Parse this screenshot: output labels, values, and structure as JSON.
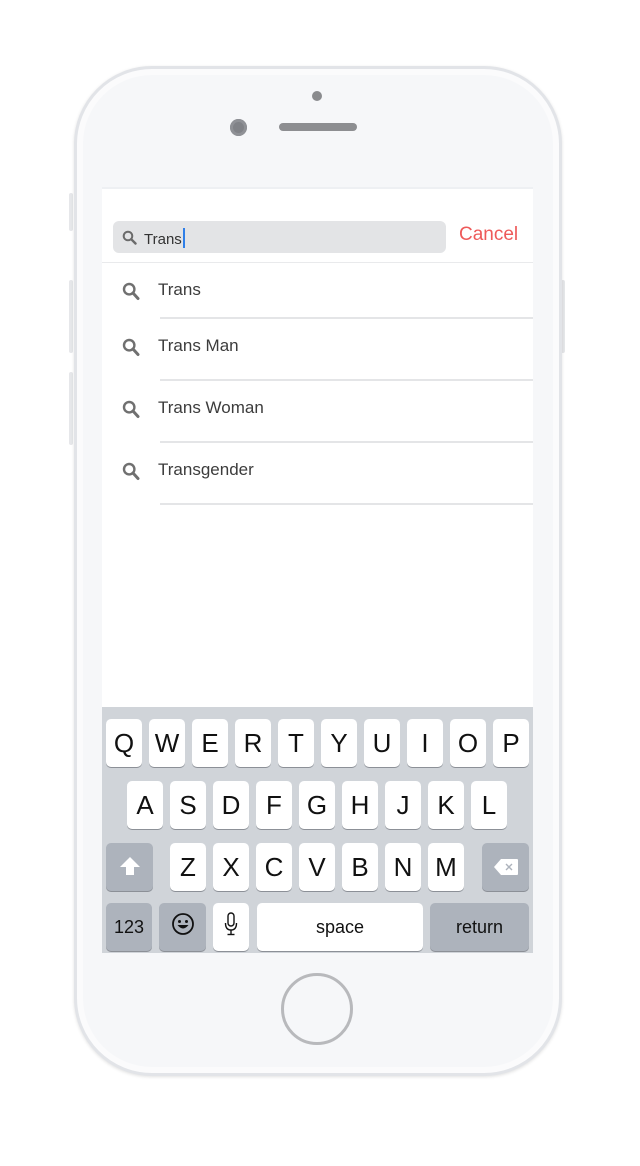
{
  "search": {
    "value": "Trans",
    "icon": "search-icon"
  },
  "cancel_label": "Cancel",
  "results": [
    {
      "label": "Trans",
      "icon": "search-icon"
    },
    {
      "label": "Trans Man",
      "icon": "search-icon"
    },
    {
      "label": "Trans Woman",
      "icon": "search-icon"
    },
    {
      "label": "Transgender",
      "icon": "search-icon"
    }
  ],
  "keyboard": {
    "row1": [
      "Q",
      "W",
      "E",
      "R",
      "T",
      "Y",
      "U",
      "I",
      "O",
      "P"
    ],
    "row2": [
      "A",
      "S",
      "D",
      "F",
      "G",
      "H",
      "J",
      "K",
      "L"
    ],
    "row3": [
      "Z",
      "X",
      "C",
      "V",
      "B",
      "N",
      "M"
    ],
    "shift_icon": "shift-icon",
    "delete_icon": "delete-icon",
    "numbers_label": "123",
    "emoji_icon": "emoji-icon",
    "mic_icon": "microphone-icon",
    "space_label": "space",
    "return_label": "return"
  },
  "colors": {
    "accent": "#ee5a5a",
    "caret": "#2f7fe8",
    "keyboard_bg": "#d0d4d9"
  }
}
